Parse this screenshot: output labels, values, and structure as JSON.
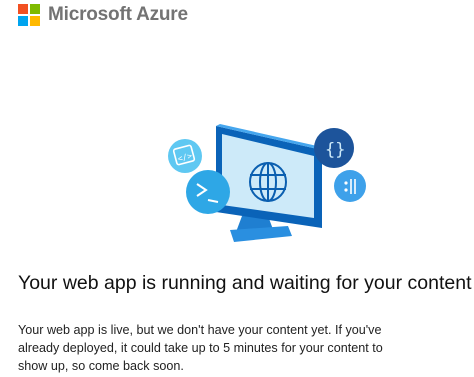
{
  "brand": {
    "name": "Microsoft Azure",
    "logo_colors": [
      "#f25022",
      "#7fba00",
      "#00a4ef",
      "#ffb900"
    ]
  },
  "illustration": {
    "icons": [
      "code-icon",
      "terminal-icon",
      "globe-icon",
      "json-braces-icon",
      "api-icon"
    ],
    "colors": {
      "monitor_frame": "#0078d4",
      "monitor_screen": "#cdeaf9",
      "monitor_stand": "#2a8fe0",
      "bubble_light": "#5fc8f2",
      "bubble_mid": "#2ea7e6",
      "bubble_dark": "#1a5ea8",
      "bubble_navy": "#224a8c"
    }
  },
  "headline": "Your web app is running and waiting for your content",
  "body": "Your web app is live, but we don't have your content yet. If you've already deployed, it could take up to 5 minutes for your content to show up, so come back soon."
}
